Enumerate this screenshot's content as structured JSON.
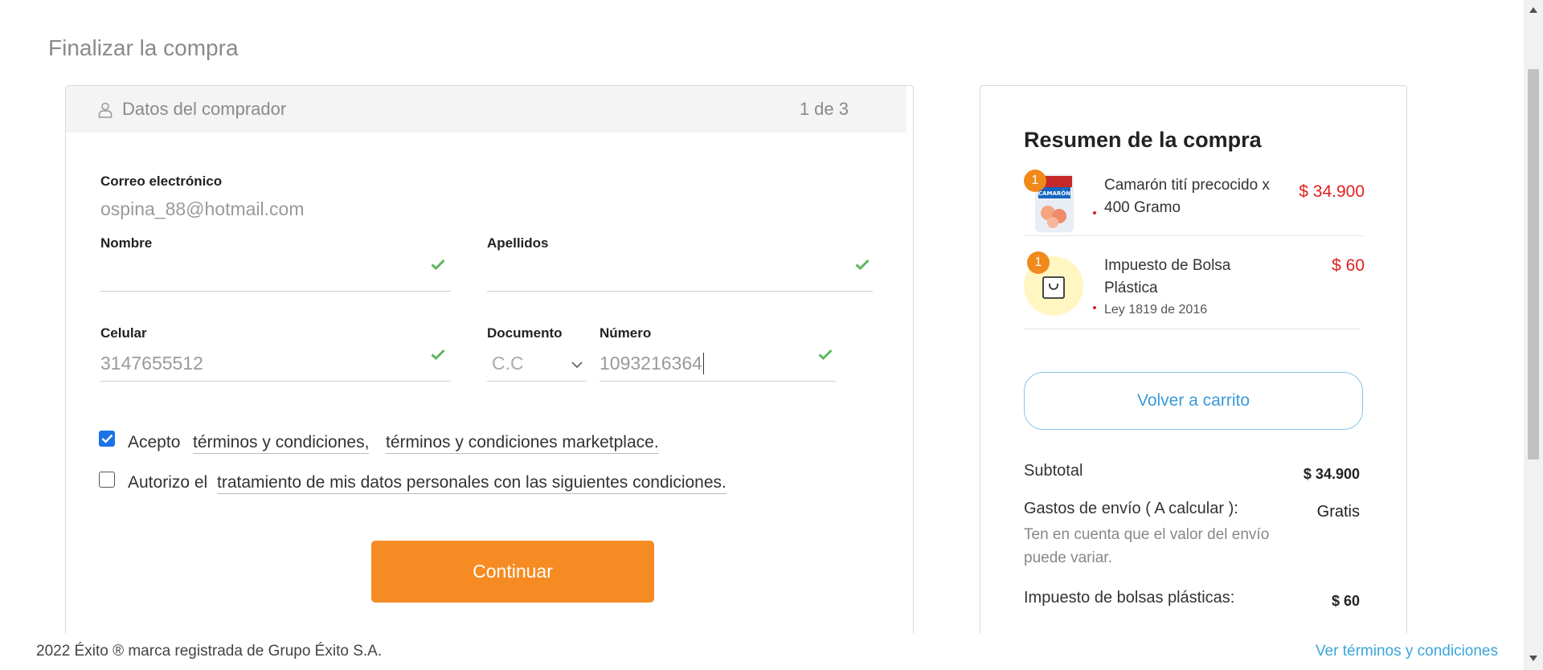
{
  "page": {
    "title": "Finalizar la compra"
  },
  "buyer": {
    "header_title": "Datos del comprador",
    "step": "1 de 3",
    "email_label": "Correo electrónico",
    "email_value": "ospina_88@hotmail.com",
    "nombre_label": "Nombre",
    "nombre_value": "",
    "apellidos_label": "Apellidos",
    "apellidos_value": "",
    "celular_label": "Celular",
    "celular_value": "3147655512",
    "documento_label": "Documento",
    "documento_value": "C.C",
    "numero_label": "Número",
    "numero_value": "1093216364",
    "terms_accept_prefix": "Acepto",
    "terms_link_1": "términos y condiciones,",
    "terms_link_2": "términos y condiciones marketplace.",
    "terms_accept_checked": true,
    "privacy_prefix": "Autorizo el",
    "privacy_link": "tratamiento de mis datos personales con las siguientes condiciones.",
    "privacy_checked": false,
    "continue_label": "Continuar"
  },
  "summary": {
    "title": "Resumen de la compra",
    "items": [
      {
        "qty": "1",
        "name": "Camarón tití precocido x 400 Gramo",
        "price": "$ 34.900",
        "thumb": "shrimp-package"
      },
      {
        "qty": "1",
        "name": "Impuesto de Bolsa Plástica",
        "note": "Ley 1819 de 2016",
        "price": "$ 60",
        "thumb": "shopping-bag-icon"
      }
    ],
    "back_label": "Volver a carrito",
    "subtotal_label": "Subtotal",
    "subtotal_value": "$ 34.900",
    "shipping_label": "Gastos de envío ( A calcular ):",
    "shipping_value": "Gratis",
    "shipping_note": "Ten en cuenta que el valor del envío puede variar.",
    "bags_label": "Impuesto de bolsas plásticas:",
    "bags_value": "$ 60"
  },
  "footer": {
    "copyright": "2022 Éxito ® marca registrada de Grupo Éxito S.A.",
    "terms_link": "Ver términos y condiciones"
  },
  "colors": {
    "accent_orange": "#f68b24",
    "price_red": "#e02020",
    "link_blue": "#3aa6d9",
    "check_green": "#5cb85c"
  }
}
